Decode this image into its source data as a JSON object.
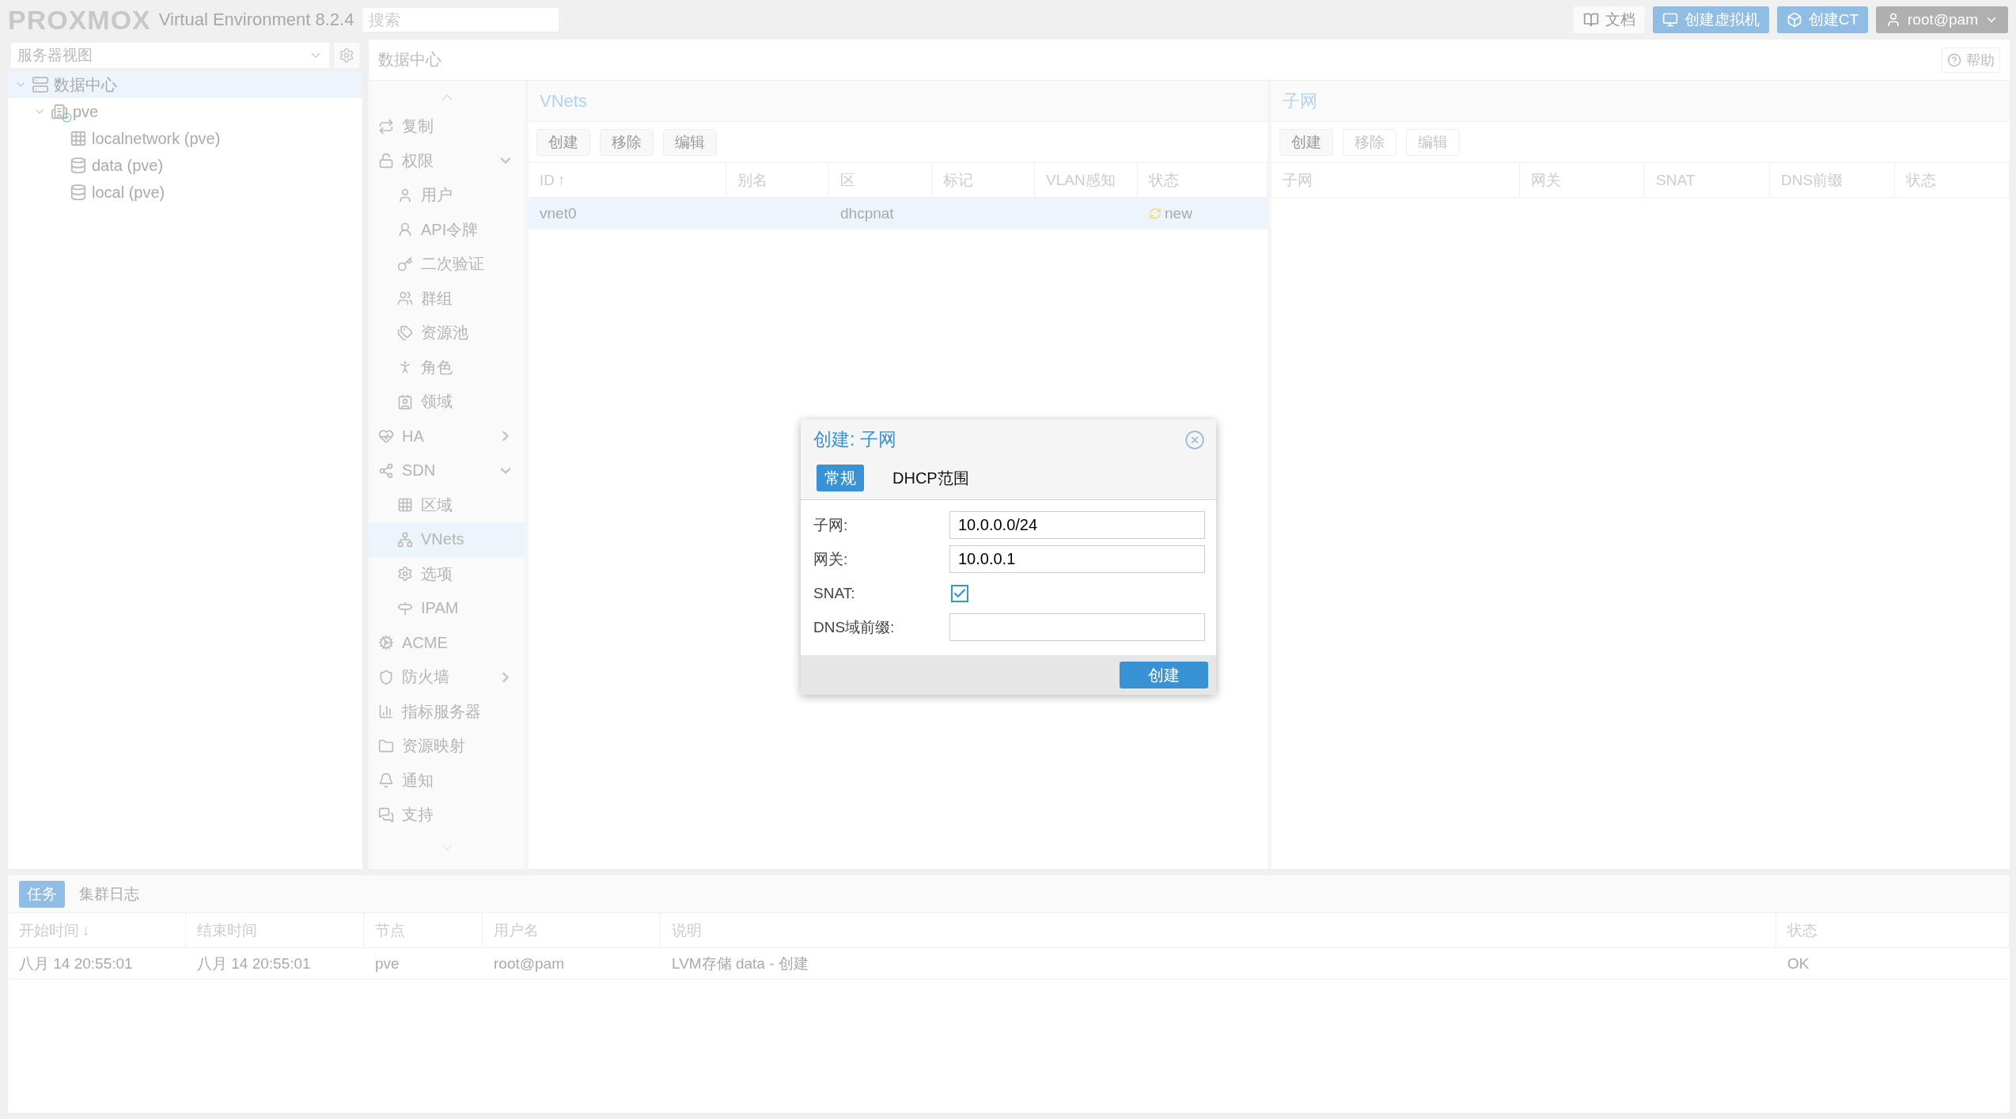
{
  "topbar": {
    "logo": "PROXMOX",
    "version": "Virtual Environment 8.2.4",
    "search": {
      "placeholder": "搜索"
    },
    "buttons": [
      {
        "kind": "docs",
        "label": "文档"
      },
      {
        "kind": "vm",
        "label": "创建虚拟机"
      },
      {
        "kind": "ct",
        "label": "创建CT"
      },
      {
        "kind": "user",
        "label": "root@pam"
      }
    ]
  },
  "sidebar": {
    "view_select": "服务器视图",
    "tree": [
      {
        "kind": "datacenter",
        "label": "数据中心",
        "selected": true,
        "expanded": true,
        "children": [
          {
            "kind": "node",
            "label": "pve",
            "selected": false,
            "expanded": true,
            "children": [
              {
                "kind": "sdn",
                "label": "localnetwork (pve)",
                "selected": false
              },
              {
                "kind": "storage",
                "label": "data (pve)",
                "selected": false
              },
              {
                "kind": "storage",
                "label": "local (pve)",
                "selected": false
              }
            ]
          }
        ]
      }
    ]
  },
  "content": {
    "title": "数据中心",
    "help": "帮助",
    "menu": [
      {
        "label": "复制",
        "selected": false
      },
      {
        "label": "权限",
        "selected": false,
        "expanded": true,
        "children": [
          {
            "label": "用户",
            "selected": false
          },
          {
            "label": "API令牌",
            "selected": false
          },
          {
            "label": "二次验证",
            "selected": false
          },
          {
            "label": "群组",
            "selected": false
          },
          {
            "label": "资源池",
            "selected": false
          },
          {
            "label": "角色",
            "selected": false
          },
          {
            "label": "领域",
            "selected": false
          }
        ]
      },
      {
        "label": "HA",
        "selected": false,
        "expanded": false
      },
      {
        "label": "SDN",
        "selected": false,
        "expanded": true,
        "children": [
          {
            "label": "区域",
            "selected": false
          },
          {
            "label": "VNets",
            "selected": true
          },
          {
            "label": "选项",
            "selected": false
          },
          {
            "label": "IPAM",
            "selected": false
          }
        ]
      },
      {
        "label": "ACME",
        "selected": false
      },
      {
        "label": "防火墙",
        "selected": false,
        "expanded": false
      },
      {
        "label": "指标服务器",
        "selected": false
      },
      {
        "label": "资源映射",
        "selected": false
      },
      {
        "label": "通知",
        "selected": false
      },
      {
        "label": "支持",
        "selected": false
      }
    ],
    "vnets": {
      "title": "VNets",
      "toolbar": [
        {
          "label": "创建",
          "disabled": false
        },
        {
          "label": "移除",
          "disabled": false
        },
        {
          "label": "编辑",
          "disabled": false
        }
      ],
      "columns": [
        {
          "label": "ID",
          "sort_mark": "↑"
        },
        {
          "label": "别名"
        },
        {
          "label": "区"
        },
        {
          "label": "标记"
        },
        {
          "label": "VLAN感知"
        },
        {
          "label": "状态"
        }
      ],
      "rows": [
        {
          "selected": true,
          "cells": [
            "vnet0",
            "",
            "dhcpnat",
            "",
            "",
            "new"
          ]
        }
      ]
    },
    "subnets": {
      "title": "子网",
      "toolbar": [
        {
          "label": "创建",
          "disabled": false
        },
        {
          "label": "移除",
          "disabled": true
        },
        {
          "label": "编辑",
          "disabled": true
        }
      ],
      "columns": [
        {
          "label": "子网"
        },
        {
          "label": "网关"
        },
        {
          "label": "SNAT"
        },
        {
          "label": "DNS前缀"
        },
        {
          "label": "状态"
        }
      ]
    }
  },
  "log_panel": {
    "tabs": [
      {
        "label": "任务",
        "selected": true
      },
      {
        "label": "集群日志",
        "selected": false
      }
    ],
    "columns": [
      {
        "label": "开始时间",
        "sort_mark": "↓"
      },
      {
        "label": "结束时间"
      },
      {
        "label": "节点"
      },
      {
        "label": "用户名"
      },
      {
        "label": "说明"
      },
      {
        "label": "状态"
      }
    ],
    "rows": [
      {
        "cells": [
          "八月 14 20:55:01",
          "八月 14 20:55:01",
          "pve",
          "root@pam",
          "LVM存储 data - 创建",
          "OK"
        ]
      }
    ]
  },
  "dialog": {
    "title": "创建: 子网",
    "tabs": [
      {
        "label": "常规",
        "selected": true
      },
      {
        "label": "DHCP范围",
        "selected": false
      }
    ],
    "fields": [
      {
        "kind": "text",
        "label": "子网:",
        "value": "10.0.0.0/24"
      },
      {
        "kind": "text",
        "label": "网关:",
        "value": "10.0.0.1"
      },
      {
        "kind": "checkbox",
        "label": "SNAT:",
        "checked": true
      },
      {
        "kind": "text",
        "label": "DNS域前缀:"
      }
    ],
    "submit": "创建"
  }
}
